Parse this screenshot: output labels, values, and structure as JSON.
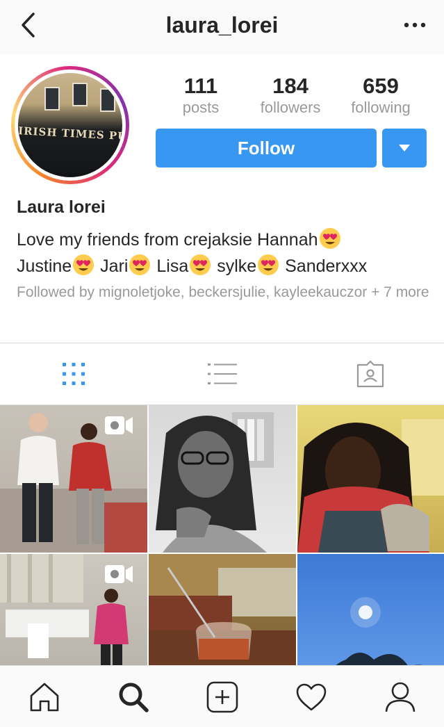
{
  "header": {
    "username": "laura_lorei",
    "back_icon": "chevron-left-icon",
    "more_icon": "more-horizontal-icon"
  },
  "profile": {
    "avatar_sign_text": "IRISH TIMES PU",
    "stats": [
      {
        "value": "111",
        "label": "posts"
      },
      {
        "value": "184",
        "label": "followers"
      },
      {
        "value": "659",
        "label": "following"
      }
    ],
    "follow_label": "Follow",
    "display_name": "Laura lorei",
    "bio_parts": [
      "Love my friends from crejaksie Hannah",
      "Justine",
      " Jari",
      " Lisa",
      " sylke",
      " Sanderxxx"
    ],
    "followed_by": "Followed by mignoletjoke, beckersjulie, kayleekauczor + 7 more"
  },
  "colors": {
    "accent": "#3897f0",
    "muted_text": "#999999",
    "divider": "#dbdbdb"
  },
  "tabs": [
    {
      "icon": "grid-icon",
      "active": true
    },
    {
      "icon": "list-icon",
      "active": false
    },
    {
      "icon": "tagged-icon",
      "active": false
    }
  ],
  "posts": [
    {
      "kind": "video"
    },
    {
      "kind": "photo"
    },
    {
      "kind": "photo"
    },
    {
      "kind": "video"
    },
    {
      "kind": "photo"
    },
    {
      "kind": "photo"
    }
  ],
  "bottom_nav": [
    {
      "icon": "home-icon"
    },
    {
      "icon": "search-icon",
      "active": true
    },
    {
      "icon": "add-post-icon"
    },
    {
      "icon": "heart-icon"
    },
    {
      "icon": "profile-icon"
    }
  ]
}
